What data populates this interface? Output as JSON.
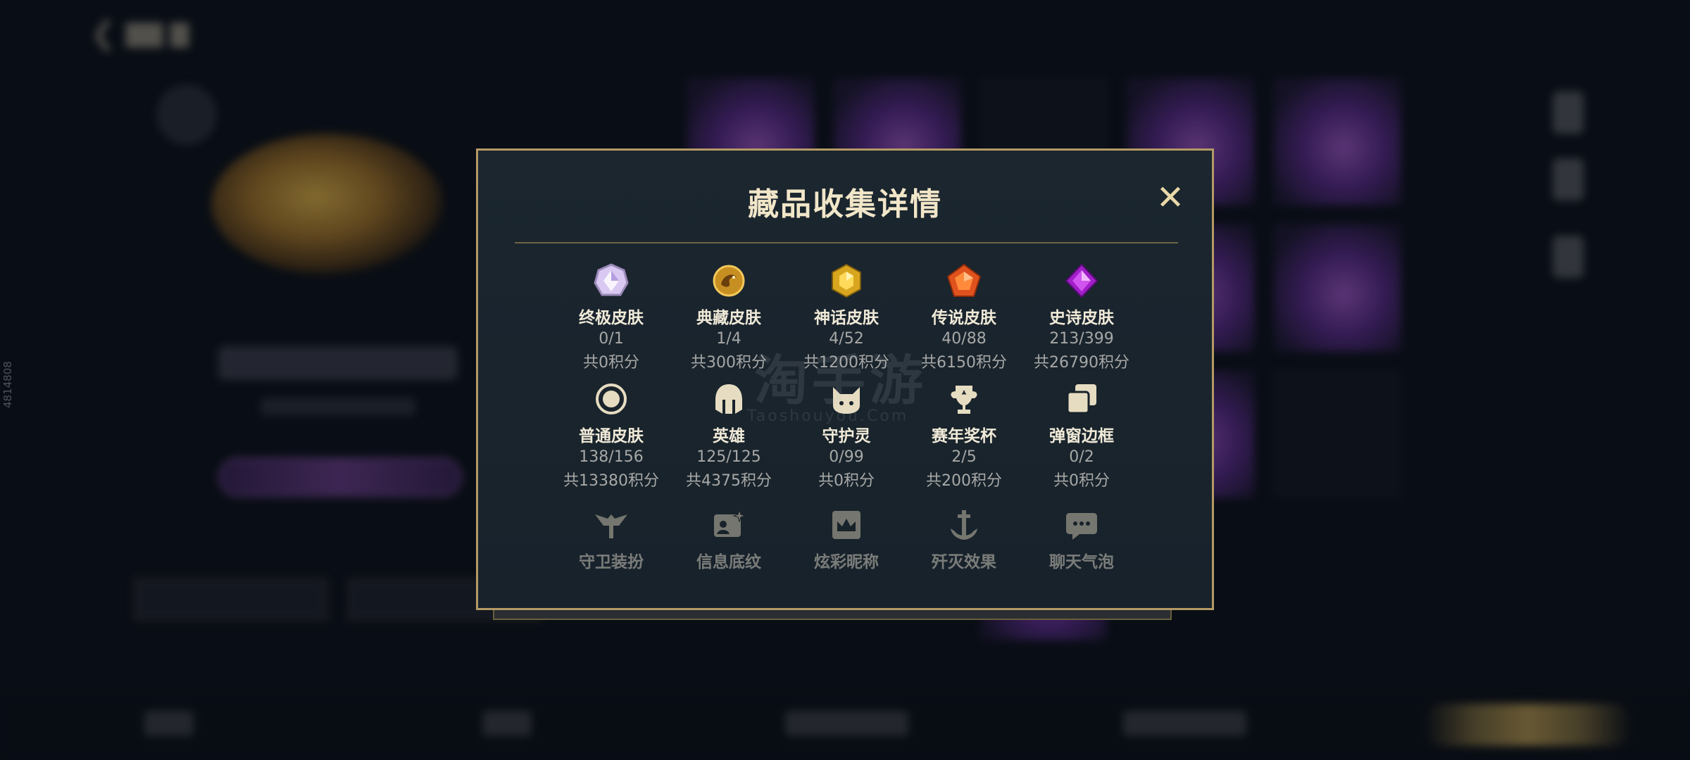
{
  "background": {
    "back_icon": "chevron-left-icon",
    "side_id": "4814808"
  },
  "modal": {
    "title": "藏品收集详情",
    "close_icon": "close-icon",
    "rows": [
      [
        {
          "icon": "ultimate-gem-icon",
          "name": "终极皮肤",
          "count": "0/1",
          "points": "共0积分"
        },
        {
          "icon": "dragon-medallion-icon",
          "name": "典藏皮肤",
          "count": "1/4",
          "points": "共300积分"
        },
        {
          "icon": "gold-hexagon-gem-icon",
          "name": "神话皮肤",
          "count": "4/52",
          "points": "共1200积分"
        },
        {
          "icon": "orange-pentagon-gem-icon",
          "name": "传说皮肤",
          "count": "40/88",
          "points": "共6150积分"
        },
        {
          "icon": "purple-diamond-gem-icon",
          "name": "史诗皮肤",
          "count": "213/399",
          "points": "共26790积分"
        }
      ],
      [
        {
          "icon": "ring-circle-icon",
          "name": "普通皮肤",
          "count": "138/156",
          "points": "共13380积分"
        },
        {
          "icon": "helmet-icon",
          "name": "英雄",
          "count": "125/125",
          "points": "共4375积分"
        },
        {
          "icon": "spirit-cat-icon",
          "name": "守护灵",
          "count": "0/99",
          "points": "共0积分"
        },
        {
          "icon": "trophy-icon",
          "name": "赛年奖杯",
          "count": "2/5",
          "points": "共200积分"
        },
        {
          "icon": "stacked-frames-icon",
          "name": "弹窗边框",
          "count": "0/2",
          "points": "共0积分"
        }
      ],
      [
        {
          "icon": "winged-guard-icon",
          "name": "守卫装扮"
        },
        {
          "icon": "card-sparkle-icon",
          "name": "信息底纹"
        },
        {
          "icon": "crown-frame-icon",
          "name": "炫彩昵称"
        },
        {
          "icon": "anchor-sword-icon",
          "name": "歼灭效果"
        },
        {
          "icon": "chat-bubble-icon",
          "name": "聊天气泡"
        }
      ]
    ]
  },
  "watermark": {
    "big": "淘手游",
    "small": "Taoshouyou.Com"
  }
}
